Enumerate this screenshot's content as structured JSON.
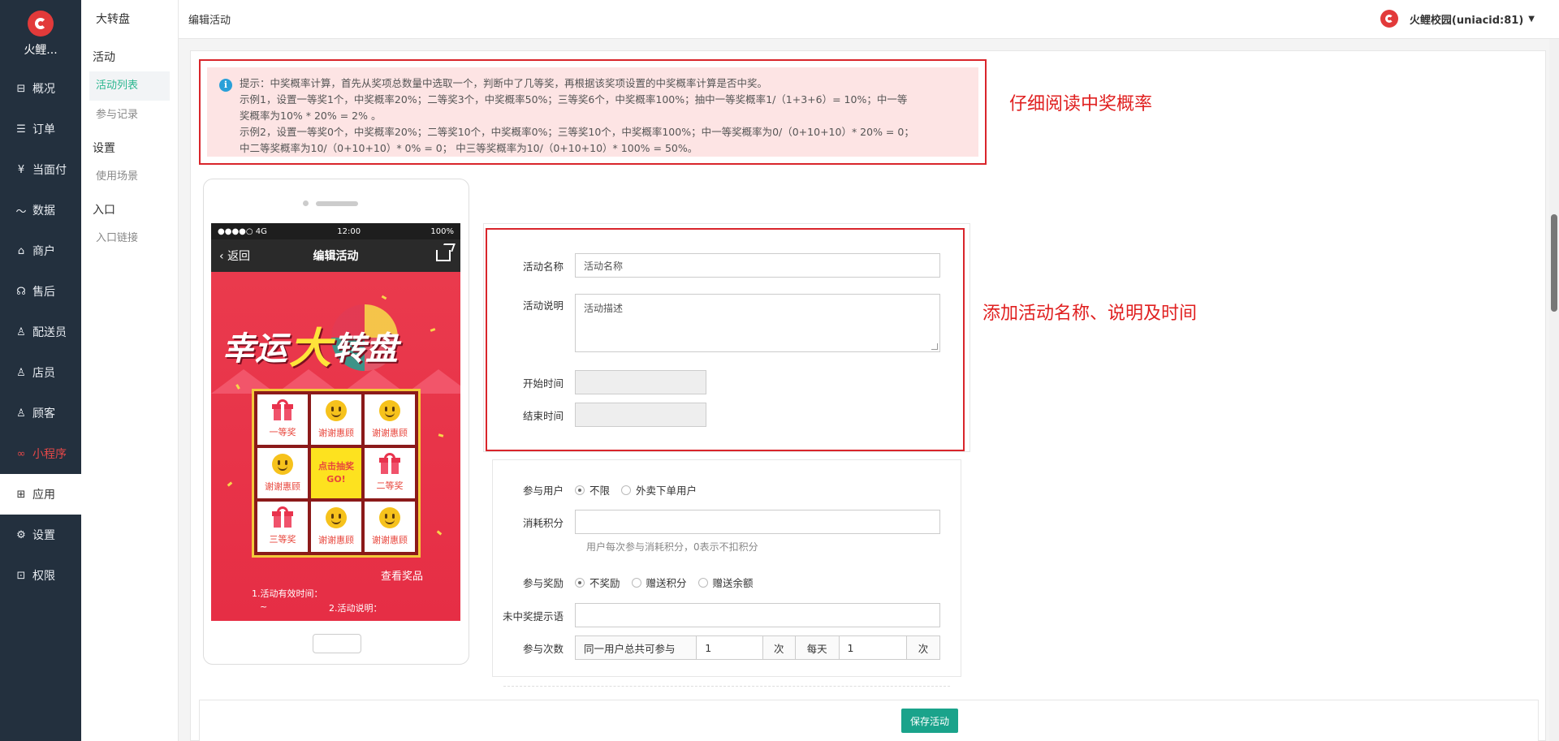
{
  "app": {
    "logo_text": "火鲤..."
  },
  "nav": {
    "items": [
      {
        "label": "概况",
        "icon": "overview-icon",
        "glyph": "⊟"
      },
      {
        "label": "订单",
        "icon": "order-icon",
        "glyph": "☰"
      },
      {
        "label": "当面付",
        "icon": "yen-icon",
        "glyph": "¥"
      },
      {
        "label": "数据",
        "icon": "chart-icon",
        "glyph": "〜"
      },
      {
        "label": "商户",
        "icon": "store-icon",
        "glyph": "⌂"
      },
      {
        "label": "售后",
        "icon": "headset-icon",
        "glyph": "☊"
      },
      {
        "label": "配送员",
        "icon": "courier-icon",
        "glyph": "♙"
      },
      {
        "label": "店员",
        "icon": "clerk-icon",
        "glyph": "♙"
      },
      {
        "label": "顾客",
        "icon": "customer-icon",
        "glyph": "♙"
      },
      {
        "label": "小程序",
        "icon": "miniapp-icon",
        "glyph": "∞"
      },
      {
        "label": "应用",
        "icon": "apps-icon",
        "glyph": "⊞"
      },
      {
        "label": "设置",
        "icon": "gear-icon",
        "glyph": "⚙"
      },
      {
        "label": "权限",
        "icon": "lock-icon",
        "glyph": "⊡"
      }
    ]
  },
  "subnav": {
    "head": "大转盘",
    "group_activity": "活动",
    "activity_list": "活动列表",
    "participation": "参与记录",
    "group_settings": "设置",
    "scenes": "使用场景",
    "group_entry": "入口",
    "entry_link": "入口链接"
  },
  "topbar": {
    "breadcrumb": "编辑活动",
    "user": "火鲤校园(uniacid:81)"
  },
  "tip": {
    "line1": "提示：中奖概率计算，首先从奖项总数量中选取一个，判断中了几等奖，再根据该奖项设置的中奖概率计算是否中奖。",
    "line2": "示例1，设置一等奖1个，中奖概率20%；二等奖3个，中奖概率50%；三等奖6个，中奖概率100%；抽中一等奖概率1/（1+3+6）= 10%；中一等",
    "line3": "奖概率为10% * 20% = 2% 。",
    "line4": "示例2，设置一等奖0个，中奖概率20%；二等奖10个，中奖概率0%；三等奖10个，中奖概率100%；中一等奖概率为0/（0+10+10）* 20% = 0；",
    "line5": "中二等奖概率为10/（0+10+10）* 0% = 0； 中三等奖概率为10/（0+10+10）* 100% = 50%。"
  },
  "annotations": {
    "a1": "仔细阅读中奖概率",
    "a2": "添加活动名称、说明及时间"
  },
  "phone": {
    "carrier": "●●●●○ 4G",
    "time": "12:00",
    "battery": "100%",
    "back": "返回",
    "title": "编辑活动",
    "brand_1": "幸运",
    "brand_2": "大",
    "brand_3": "转盘",
    "cells": [
      {
        "type": "gift",
        "label": "一等奖"
      },
      {
        "type": "smile",
        "label": "谢谢惠顾"
      },
      {
        "type": "smile",
        "label": "谢谢惠顾"
      },
      {
        "type": "smile",
        "label": "谢谢惠顾"
      },
      {
        "type": "center",
        "label": "点击抽奖"
      },
      {
        "type": "gift",
        "label": "二等奖"
      },
      {
        "type": "gift",
        "label": "三等奖"
      },
      {
        "type": "smile",
        "label": "谢谢惠顾"
      },
      {
        "type": "smile",
        "label": "谢谢惠顾"
      }
    ],
    "center_go": "GO!",
    "see_prize": "查看奖品",
    "info1": "1.活动有效时间：",
    "info2": "2.活动说明：",
    "info3": "~"
  },
  "form": {
    "name_label": "活动名称",
    "name_placeholder": "活动名称",
    "desc_label": "活动说明",
    "desc_placeholder": "活动描述",
    "start_label": "开始时间",
    "start_value": "",
    "end_label": "结束时间",
    "end_value": "",
    "users_label": "参与用户",
    "users_options": [
      "不限",
      "外卖下单用户"
    ],
    "users_selected": 0,
    "points_label": "消耗积分",
    "points_value": "",
    "points_help": "用户每次参与消耗积分，0表示不扣积分",
    "reward_label": "参与奖励",
    "reward_options": [
      "不奖励",
      "赠送积分",
      "赠送余额"
    ],
    "reward_selected": 0,
    "miss_label": "未中奖提示语",
    "miss_value": "",
    "times_label": "参与次数",
    "times_total_prefix": "同一用户总共可参与",
    "times_total_value": "1",
    "times_unit": "次",
    "times_daily_prefix": "每天",
    "times_daily_value": "1",
    "times_daily_unit": "次"
  },
  "actions": {
    "save": "保存活动"
  }
}
